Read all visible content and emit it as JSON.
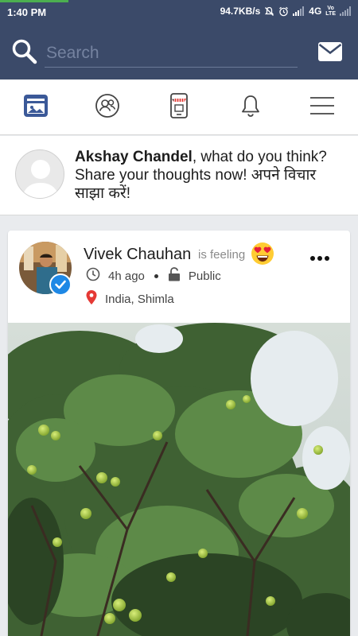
{
  "status_bar": {
    "time": "1:40 PM",
    "net_speed": "94.7KB/s",
    "network_type": "4G",
    "volte_top": "Vo",
    "volte_bottom": "LTE",
    "bar_color": "#3b4a69",
    "progress_color": "#4caf50",
    "progress_fraction": 0.19
  },
  "header": {
    "search_placeholder": "Search",
    "icons": [
      "search-icon",
      "mail-icon"
    ],
    "bg_color": "#3b4a69"
  },
  "nav": {
    "items": [
      {
        "name": "news-feed",
        "icon": "news-feed-icon",
        "active": true
      },
      {
        "name": "friends",
        "icon": "friends-icon",
        "active": false
      },
      {
        "name": "mobile-shop",
        "icon": "mobile-shop-icon",
        "active": false
      },
      {
        "name": "notifications",
        "icon": "bell-icon",
        "active": false
      },
      {
        "name": "menu",
        "icon": "menu-icon",
        "active": false
      }
    ],
    "active_color": "#3b5998"
  },
  "composer": {
    "user_name": "Akshay Chandel",
    "prompt": ", what do you think? Share your thoughts now! अपने विचार साझा करें!"
  },
  "post": {
    "author": "Vivek Chauhan",
    "feeling_label": "is feeling",
    "feeling_emoji": "heart-eyes-emoji",
    "time_ago": "4h ago",
    "privacy": "Public",
    "location": "India, Shimla",
    "verified": true,
    "verified_color": "#1e88e5",
    "location_pin_color": "#e53935"
  }
}
